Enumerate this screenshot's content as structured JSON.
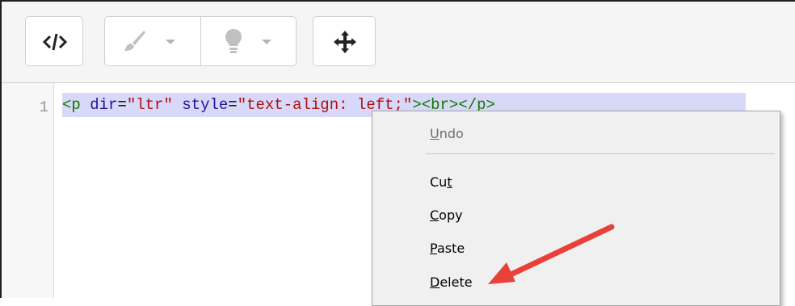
{
  "toolbar": {
    "code_view_icon": "code-icon",
    "style_icon": "brush-icon",
    "inspire_icon": "lightbulb-icon",
    "move_icon": "move-arrows-icon"
  },
  "editor": {
    "line_number": "1",
    "code": {
      "t1": "<p ",
      "a1": "dir",
      "e1": "=",
      "s1": "\"ltr\"",
      "sp": " ",
      "a2": "style",
      "e2": "=",
      "s2": "\"text-align: left;\"",
      "t2": "><br></p>"
    }
  },
  "context_menu": {
    "undo": {
      "pre": "",
      "key": "U",
      "post": "ndo"
    },
    "cut": {
      "pre": "Cu",
      "key": "t",
      "post": ""
    },
    "copy": {
      "pre": "",
      "key": "C",
      "post": "opy"
    },
    "paste": {
      "pre": "",
      "key": "P",
      "post": "aste"
    },
    "delete": {
      "pre": "",
      "key": "D",
      "post": "elete"
    }
  },
  "colors": {
    "selection": "#d8d8f8",
    "arrow": "#e8413a",
    "tag": "#117700",
    "attr": "#221199",
    "string": "#aa1111"
  }
}
